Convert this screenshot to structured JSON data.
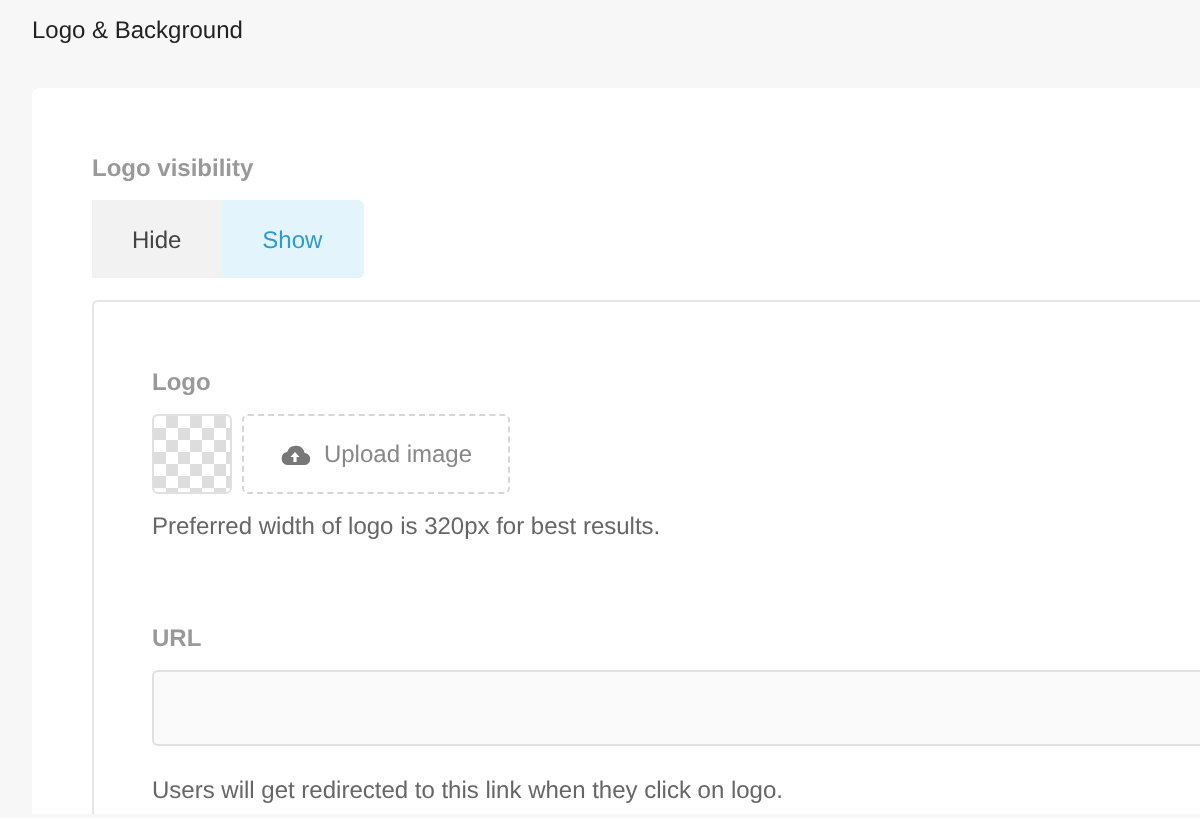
{
  "section_title": "Logo & Background",
  "visibility": {
    "label": "Logo visibility",
    "options": [
      {
        "label": "Hide",
        "selected": false
      },
      {
        "label": "Show",
        "selected": true
      }
    ]
  },
  "logo": {
    "label": "Logo",
    "upload_button": "Upload image",
    "hint": "Preferred width of logo is 320px for best results."
  },
  "url": {
    "label": "URL",
    "hint": "Users will get redirected to this link when they click on logo."
  }
}
